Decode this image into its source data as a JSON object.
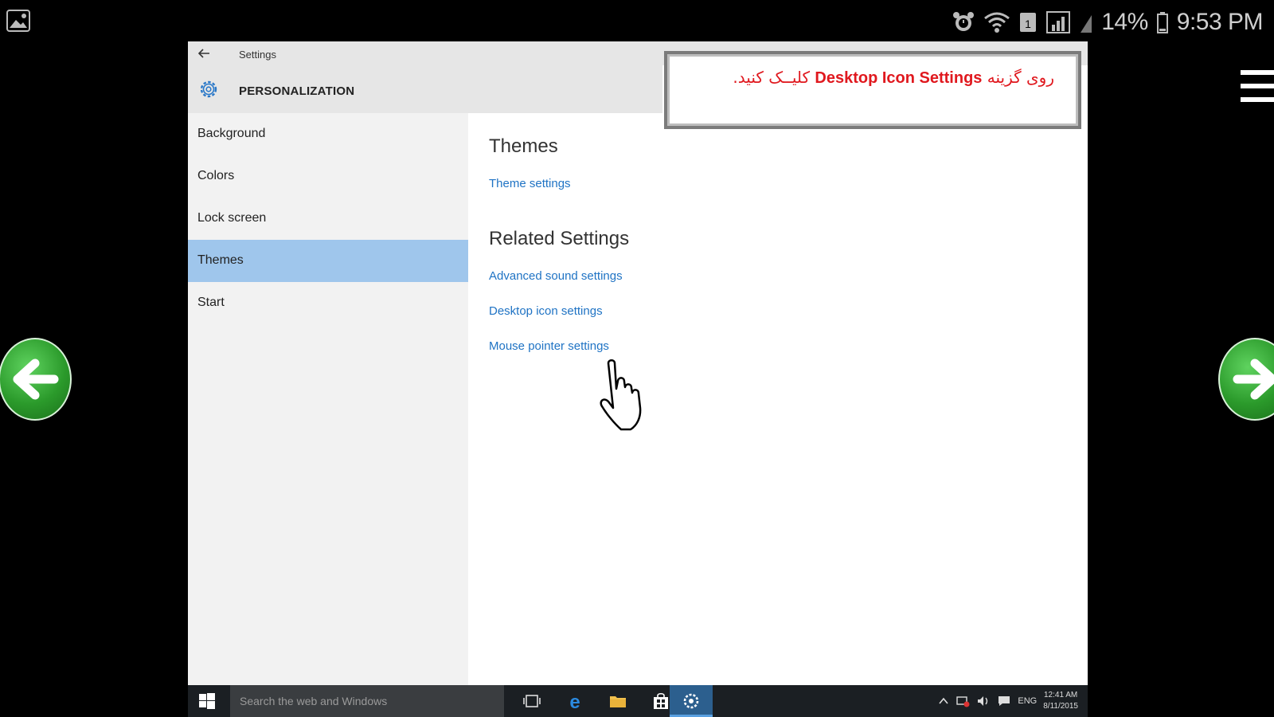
{
  "status_bar": {
    "battery": "14%",
    "time": "9:53 PM"
  },
  "window": {
    "title": "Settings",
    "section": "PERSONALIZATION"
  },
  "sidebar": {
    "items": [
      {
        "label": "Background"
      },
      {
        "label": "Colors"
      },
      {
        "label": "Lock screen"
      },
      {
        "label": "Themes"
      },
      {
        "label": "Start"
      }
    ]
  },
  "content": {
    "title": "Themes",
    "theme_settings_link": "Theme settings",
    "related_title": "Related Settings",
    "links": [
      {
        "label": "Advanced sound settings"
      },
      {
        "label": "Desktop icon settings"
      },
      {
        "label": "Mouse pointer settings"
      }
    ]
  },
  "instruction": {
    "prefix": "روی گزینه",
    "emphasis": "Desktop Icon Settings",
    "suffix": "کلیــک کنید."
  },
  "taskbar": {
    "search_placeholder": "Search the web and Windows",
    "language": "ENG",
    "time": "12:41 AM",
    "date": "8/11/2015"
  },
  "colors": {
    "accent": "#9fc6ec",
    "link": "#1f73c4",
    "instruction_text": "#e0181e",
    "nav_arrow": "#2b9a2b"
  }
}
